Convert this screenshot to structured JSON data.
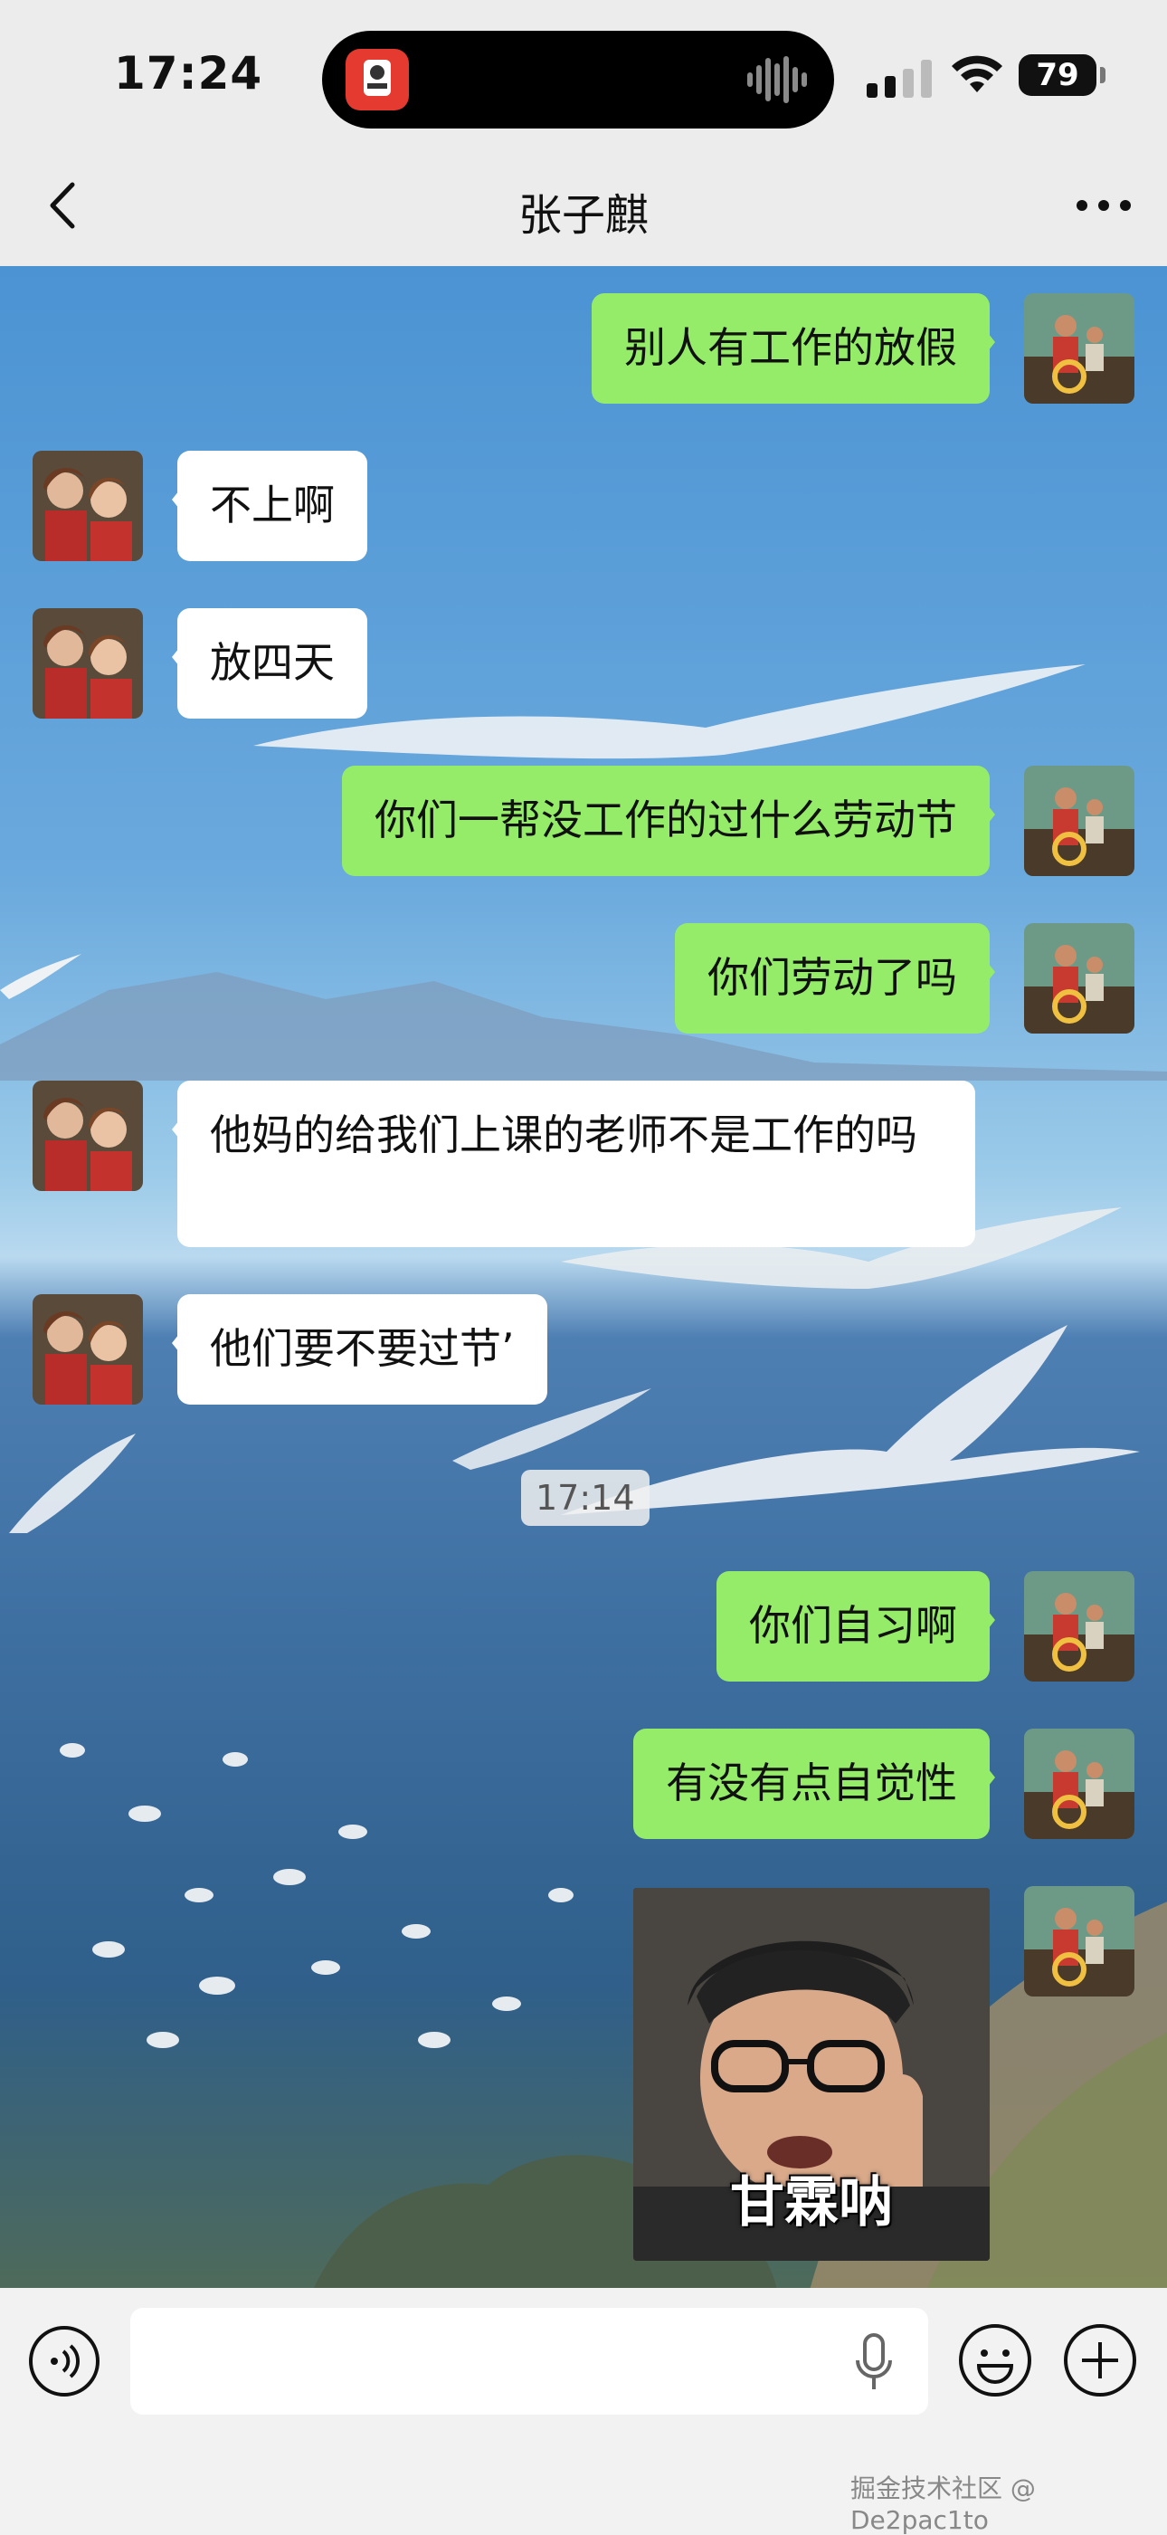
{
  "status_bar": {
    "time": "17:24",
    "battery": "79"
  },
  "nav": {
    "title": "张子麒"
  },
  "messages": [
    {
      "side": "me",
      "text": "别人有工作的放假"
    },
    {
      "side": "other",
      "text": "不上啊"
    },
    {
      "side": "other",
      "text": "放四天"
    },
    {
      "side": "me",
      "text": "你们一帮没工作的过什么劳动节"
    },
    {
      "side": "me",
      "text": "你们劳动了吗"
    },
    {
      "side": "other",
      "text": "他妈的给我们上课的老师不是工作的吗"
    },
    {
      "side": "other",
      "text": "他们要不要过节’"
    },
    {
      "side": "me",
      "text": "你们自习啊"
    },
    {
      "side": "me",
      "text": "有没有点自觉性"
    }
  ],
  "timestamp": "17:14",
  "sticker": {
    "caption": "甘霖呐"
  },
  "watermark": "掘金技术社区 @ De2pac1to",
  "colors": {
    "my_bubble": "#95ec69",
    "other_bubble": "#ffffff",
    "bar_bg": "#ececec"
  }
}
